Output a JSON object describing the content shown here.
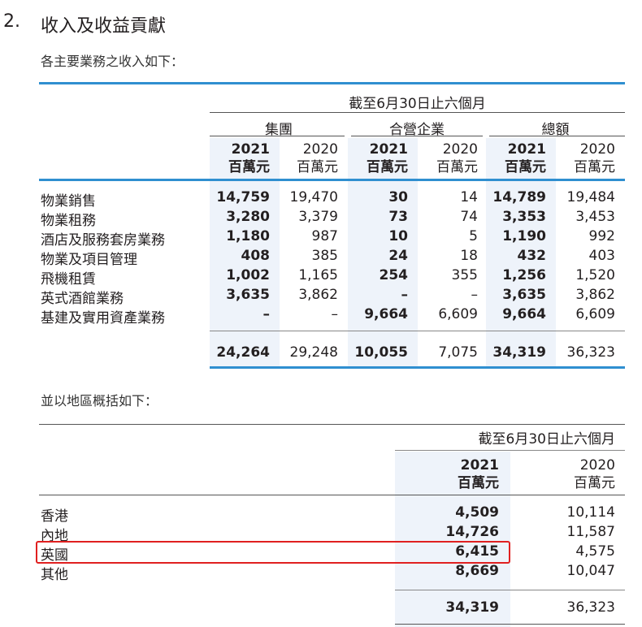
{
  "section": {
    "number": "2.",
    "title": "收入及收益貢獻",
    "intro": "各主要業務之收入如下：",
    "intro2": "並以地區概括如下："
  },
  "table1": {
    "period": "截至6月30日止六個月",
    "groups": [
      "集團",
      "合營企業",
      "總額"
    ],
    "years": [
      "2021",
      "2020",
      "2021",
      "2020",
      "2021",
      "2020"
    ],
    "unit": "百萬元",
    "rows": [
      {
        "label": "物業銷售",
        "values": [
          "14,759",
          "19,470",
          "30",
          "14",
          "14,789",
          "19,484"
        ]
      },
      {
        "label": "物業租務",
        "values": [
          "3,280",
          "3,379",
          "73",
          "74",
          "3,353",
          "3,453"
        ]
      },
      {
        "label": "酒店及服務套房業務",
        "values": [
          "1,180",
          "987",
          "10",
          "5",
          "1,190",
          "992"
        ]
      },
      {
        "label": "物業及項目管理",
        "values": [
          "408",
          "385",
          "24",
          "18",
          "432",
          "403"
        ]
      },
      {
        "label": "飛機租賃",
        "values": [
          "1,002",
          "1,165",
          "254",
          "355",
          "1,256",
          "1,520"
        ]
      },
      {
        "label": "英式酒館業務",
        "values": [
          "3,635",
          "3,862",
          "–",
          "–",
          "3,635",
          "3,862"
        ]
      },
      {
        "label": "基建及實用資產業務",
        "values": [
          "–",
          "–",
          "9,664",
          "6,609",
          "9,664",
          "6,609"
        ]
      }
    ],
    "total": [
      "24,264",
      "29,248",
      "10,055",
      "7,075",
      "34,319",
      "36,323"
    ]
  },
  "table2": {
    "period": "截至6月30日止六個月",
    "years": [
      "2021",
      "2020"
    ],
    "unit": "百萬元",
    "rows": [
      {
        "label": "香港",
        "values": [
          "4,509",
          "10,114"
        ]
      },
      {
        "label": "內地",
        "values": [
          "14,726",
          "11,587"
        ]
      },
      {
        "label": "英國",
        "values": [
          "6,415",
          "4,575"
        ]
      },
      {
        "label": "其他",
        "values": [
          "8,669",
          "10,047"
        ]
      }
    ],
    "total": [
      "34,319",
      "36,323"
    ]
  },
  "colors": {
    "accent": "#2f8fd0",
    "highlight": "#eef3fa",
    "annotation": "#e02020"
  }
}
